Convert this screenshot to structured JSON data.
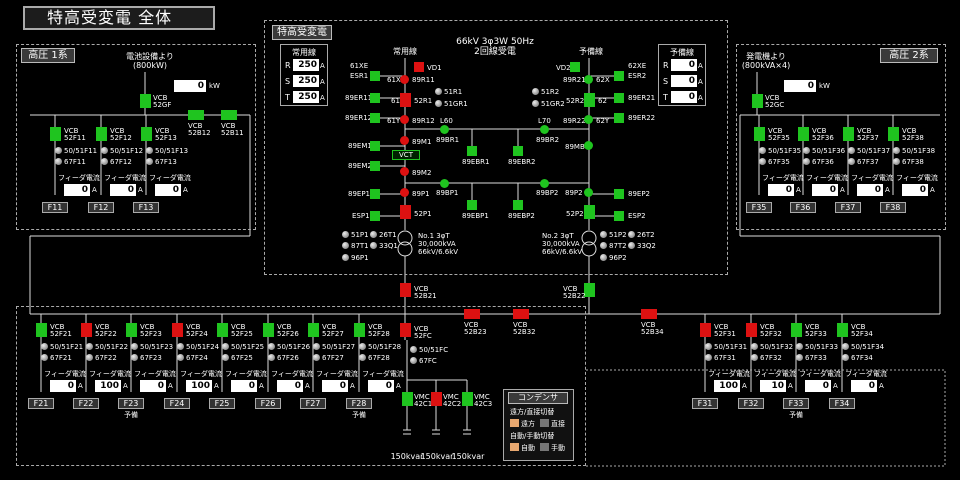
{
  "title": "特高受変電 全体",
  "sections": {
    "hv1": "高圧 1系",
    "hv2": "高圧 2系",
    "eh": "特高受変電",
    "cond": "コンデンサ"
  },
  "incoming": {
    "line1": "66kV 3φ3W 50Hz",
    "line2": "2回線受電",
    "main": "常用線",
    "reserve": "予備線"
  },
  "labels": {
    "battery": "電池設備より",
    "battery_sub": "(800kW)",
    "gen": "発電機より",
    "gen_sub": "(800kVA×4)",
    "kw": "kW",
    "feeder_current": "フィーダ電流",
    "amp": "A",
    "yobi": "予備",
    "vct": "VCT"
  },
  "meters": {
    "main": {
      "title": "常用線",
      "R": "250",
      "S": "250",
      "T": "250"
    },
    "res": {
      "title": "予備線",
      "R": "0",
      "S": "0",
      "T": "0"
    },
    "bat_kw": "0",
    "gen_kw": "0"
  },
  "tr1": {
    "name": "No.1 3φT",
    "cap": "30,000kVA",
    "volt": "66kV/6.6kV"
  },
  "tr2": {
    "name": "No.2 3φT",
    "cap": "30,000kVA",
    "volt": "66kV/6.6kV"
  },
  "cond": {
    "l1": "遠方/直接切替",
    "a": "遠方",
    "b": "直接",
    "l2": "自動/手動切替",
    "c": "自動",
    "d": "手動",
    "kvar": "150kvar"
  },
  "ehs": {
    "left": [
      "61XE",
      "ESR1",
      "89ER11",
      "89ER12",
      "89EM1",
      "89EM2",
      "89EP1",
      "ESP1"
    ],
    "leftcol": [
      "61X",
      "89R11",
      "61",
      "52R1",
      "61Y",
      "89R12",
      "89M1",
      "89M2",
      "89P1",
      "52P1"
    ],
    "lrel": [
      "51R1",
      "51GR1",
      "51P1",
      "26T1",
      "87T1",
      "33Q1",
      "96P1"
    ],
    "right": [
      "62XE",
      "ESR2",
      "89ER21",
      "89ER22",
      "89EP2",
      "ESP2"
    ],
    "rightcol": [
      "VD2",
      "89R21",
      "62X",
      "52R2",
      "62",
      "89R22",
      "62Y",
      "89MB",
      "89P2",
      "52P2"
    ],
    "rrel": [
      "51R2",
      "51GR2",
      "51P2",
      "26T2",
      "87T2",
      "33Q2",
      "96P2"
    ],
    "mid": [
      "VD1",
      "L60",
      "89BR1",
      "89EBR1",
      "89EBR2",
      "L70",
      "89BR2",
      "89BP1",
      "89EBP1",
      "89EBP2",
      "89BP2"
    ]
  },
  "vcb_b": {
    "c52GF": "52GF",
    "c52B12": "52B12",
    "c52B11": "52B11",
    "c52GC": "52GC",
    "c52B21": "52B21",
    "c52B22": "52B22",
    "c52B23": "52B23",
    "c52B32": "52B32",
    "c52B34": "52B34",
    "c52FC": "52FC",
    "vcb": "VCB",
    "vmc": "VMC",
    "c42C1": "42C1",
    "c42C2": "42C2",
    "c42C3": "42C3",
    "r5051FC": "50/51FC",
    "r67FC": "67FC"
  },
  "fu1": [
    {
      "n": "11",
      "cur": "0",
      "st": "g"
    },
    {
      "n": "12",
      "cur": "0",
      "st": "g"
    },
    {
      "n": "13",
      "cur": "0",
      "st": "g"
    }
  ],
  "fu2": [
    {
      "n": "35",
      "cur": "0",
      "st": "g"
    },
    {
      "n": "36",
      "cur": "0",
      "st": "g"
    },
    {
      "n": "37",
      "cur": "0",
      "st": "g"
    },
    {
      "n": "38",
      "cur": "0",
      "st": "g"
    }
  ],
  "fb1": [
    {
      "n": "21",
      "cur": "0",
      "st": "g"
    },
    {
      "n": "22",
      "cur": "100",
      "st": "r"
    },
    {
      "n": "23",
      "cur": "0",
      "st": "g"
    },
    {
      "n": "24",
      "cur": "100",
      "st": "r"
    },
    {
      "n": "25",
      "cur": "0",
      "st": "g"
    },
    {
      "n": "26",
      "cur": "0",
      "st": "g"
    },
    {
      "n": "27",
      "cur": "0",
      "st": "g"
    },
    {
      "n": "28",
      "cur": "0",
      "st": "g"
    }
  ],
  "fb2": [
    {
      "n": "31",
      "cur": "100",
      "st": "r"
    },
    {
      "n": "32",
      "cur": "10",
      "st": "r"
    },
    {
      "n": "33",
      "cur": "0",
      "st": "g"
    },
    {
      "n": "34",
      "cur": "0",
      "st": "g"
    }
  ]
}
